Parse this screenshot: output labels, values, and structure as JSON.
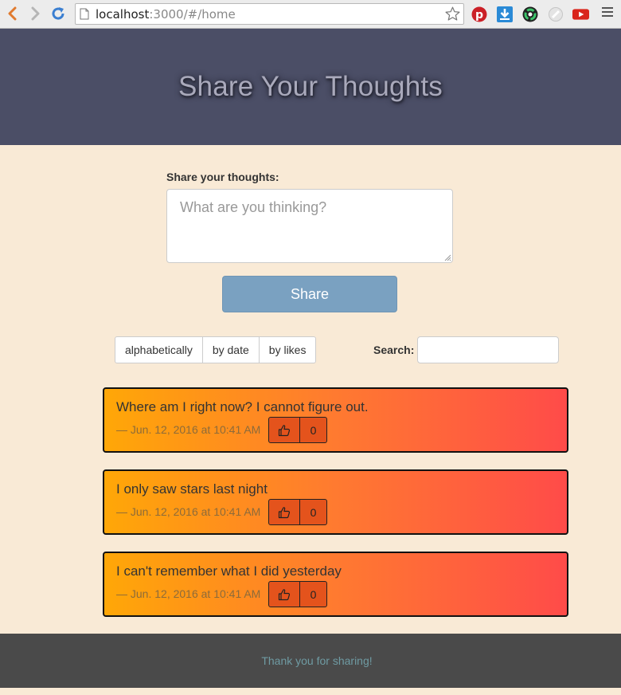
{
  "browser": {
    "url_host": "localhost",
    "url_path": ":3000/#/home",
    "icons": [
      "back-icon",
      "forward-icon",
      "reload-icon",
      "page-icon",
      "star-icon",
      "pinterest-icon",
      "download-icon",
      "color-picker-icon",
      "extension-icon",
      "youtube-icon",
      "menu-icon"
    ]
  },
  "header": {
    "title": "Share Your Thoughts"
  },
  "share_form": {
    "label": "Share your thoughts:",
    "placeholder": "What are you thinking?",
    "button_label": "Share"
  },
  "sort": {
    "options": [
      "alphabetically",
      "by date",
      "by likes"
    ]
  },
  "search": {
    "label": "Search:",
    "value": ""
  },
  "thoughts": [
    {
      "text": "Where am I right now? I cannot figure out.",
      "meta": "— Jun. 12, 2016 at 10:41 AM",
      "likes": "0"
    },
    {
      "text": "I only saw stars last night",
      "meta": "— Jun. 12, 2016 at 10:41 AM",
      "likes": "0"
    },
    {
      "text": "I can't remember what I did yesterday",
      "meta": "— Jun. 12, 2016 at 10:41 AM",
      "likes": "0"
    }
  ],
  "footer": {
    "text": "Thank you for sharing!"
  },
  "colors": {
    "header_bg": "#4b4e66",
    "page_bg": "#f9ead6",
    "share_button": "#7aa1c1",
    "card_gradient_start": "#ffa707",
    "card_gradient_end": "#ff4b49",
    "like_button": "#e4531c",
    "footer_bg": "#4a4a4a"
  }
}
